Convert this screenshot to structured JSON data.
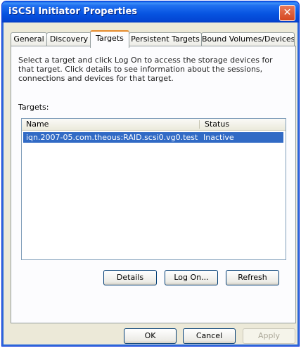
{
  "window": {
    "title": "iSCSI Initiator Properties",
    "close_glyph": "✕"
  },
  "tabs": [
    {
      "label": "General"
    },
    {
      "label": "Discovery"
    },
    {
      "label": "Targets"
    },
    {
      "label": "Persistent Targets"
    },
    {
      "label": "Bound Volumes/Devices"
    }
  ],
  "active_tab": "Targets",
  "panel": {
    "description": "Select a target and click Log On to access the storage devices for that target. Click details to see information about the sessions, connections and devices for that target.",
    "targets_label": "Targets:",
    "columns": {
      "name": "Name",
      "status": "Status"
    },
    "rows": [
      {
        "name": "iqn.2007-05.com.theous:RAID.scsi0.vg0.test",
        "status": "Inactive",
        "selected": true
      }
    ],
    "buttons": {
      "details": "Details",
      "log_on": "Log On...",
      "refresh": "Refresh"
    }
  },
  "footer": {
    "ok": "OK",
    "cancel": "Cancel",
    "apply": "Apply"
  },
  "colors": {
    "title_bar": "#0653e0",
    "selection": "#316ac5",
    "active_tab_accent": "#e68b2c"
  }
}
